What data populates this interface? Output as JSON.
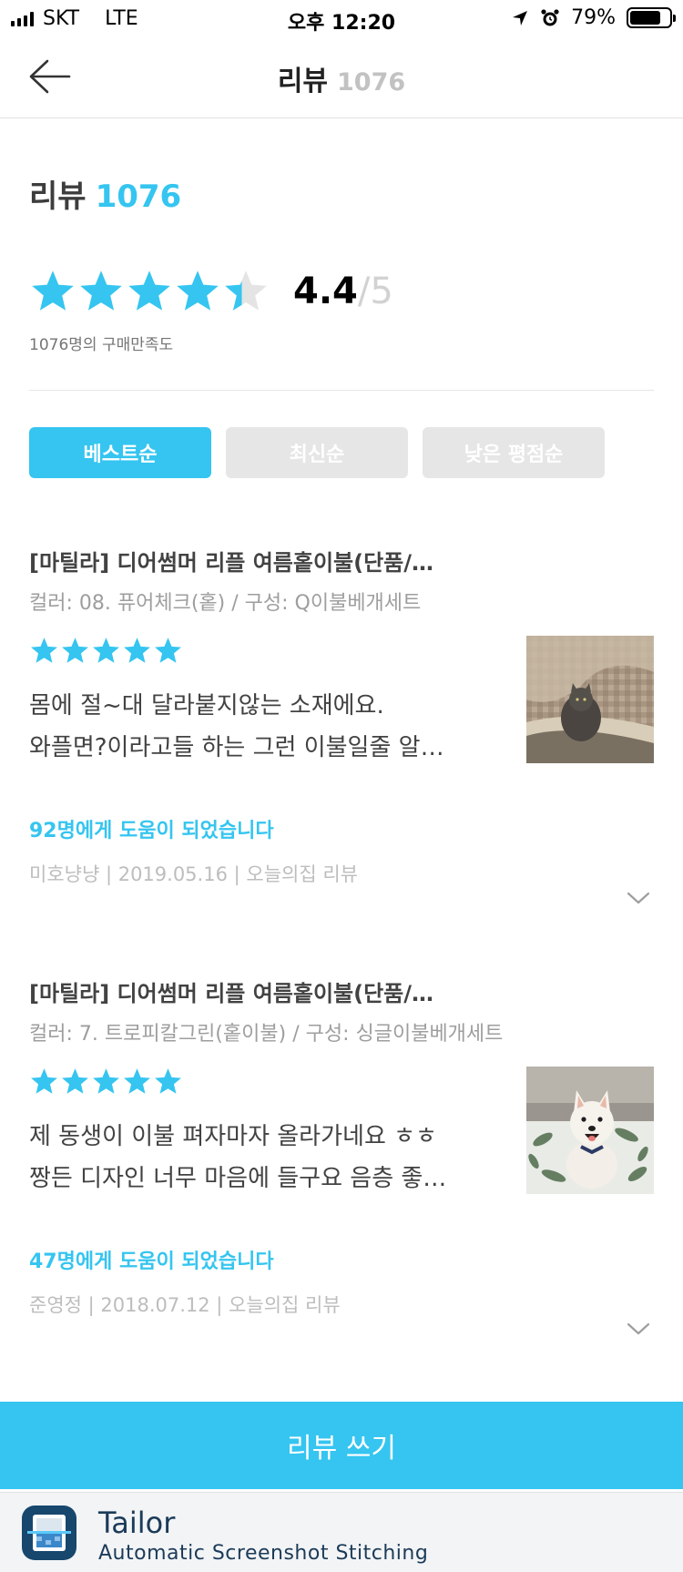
{
  "status_bar": {
    "carrier": "SKT",
    "network": "LTE",
    "time": "오후 12:20",
    "battery": "79%",
    "battery_level": 0.79
  },
  "nav": {
    "title": "리뷰",
    "count": "1076"
  },
  "summary": {
    "title": "리뷰",
    "count": "1076",
    "rating_value": "4.4",
    "rating_max": "/5",
    "rating": 4.4,
    "caption": "1076명의 구매만족도"
  },
  "sort_options": [
    {
      "label": "베스트순",
      "active": true
    },
    {
      "label": "최신순",
      "active": false
    },
    {
      "label": "낮은 평점순",
      "active": false
    }
  ],
  "reviews": [
    {
      "title": "[마틸라] 디어썸머 리플 여름홑이불(단품/…",
      "option": "컬러: 08. 퓨어체크(홑) / 구성: Q이불베개세트",
      "stars": 5,
      "body_line1": "몸에 절~대 달라붙지않는 소재에요.",
      "body_line2": "와플면?이라고들 하는 그런 이불일줄 알…",
      "helpful": "92명에게 도움이 되었습니다",
      "meta": "미호냥냥 | 2019.05.16 | 오늘의집 리뷰"
    },
    {
      "title": "[마틸라] 디어썸머 리플 여름홑이불(단품/…",
      "option": "컬러: 7. 트로피칼그린(홑이불) / 구성: 싱글이불베개세트",
      "stars": 5,
      "body_line1": "제 동생이 이불 펴자마자 올라가네요 ㅎㅎ",
      "body_line2": "짱든 디자인 너무 마음에 들구요 음층 좋…",
      "helpful": "47명에게 도움이 되었습니다",
      "meta": "준영정 | 2018.07.12 | 오늘의집 리뷰"
    }
  ],
  "write_button": "리뷰 쓰기",
  "footer": {
    "app_name": "Tailor",
    "app_desc": "Automatic Screenshot Stitching"
  },
  "colors": {
    "accent": "#35c5f0",
    "star_empty": "#e4e4e4"
  }
}
